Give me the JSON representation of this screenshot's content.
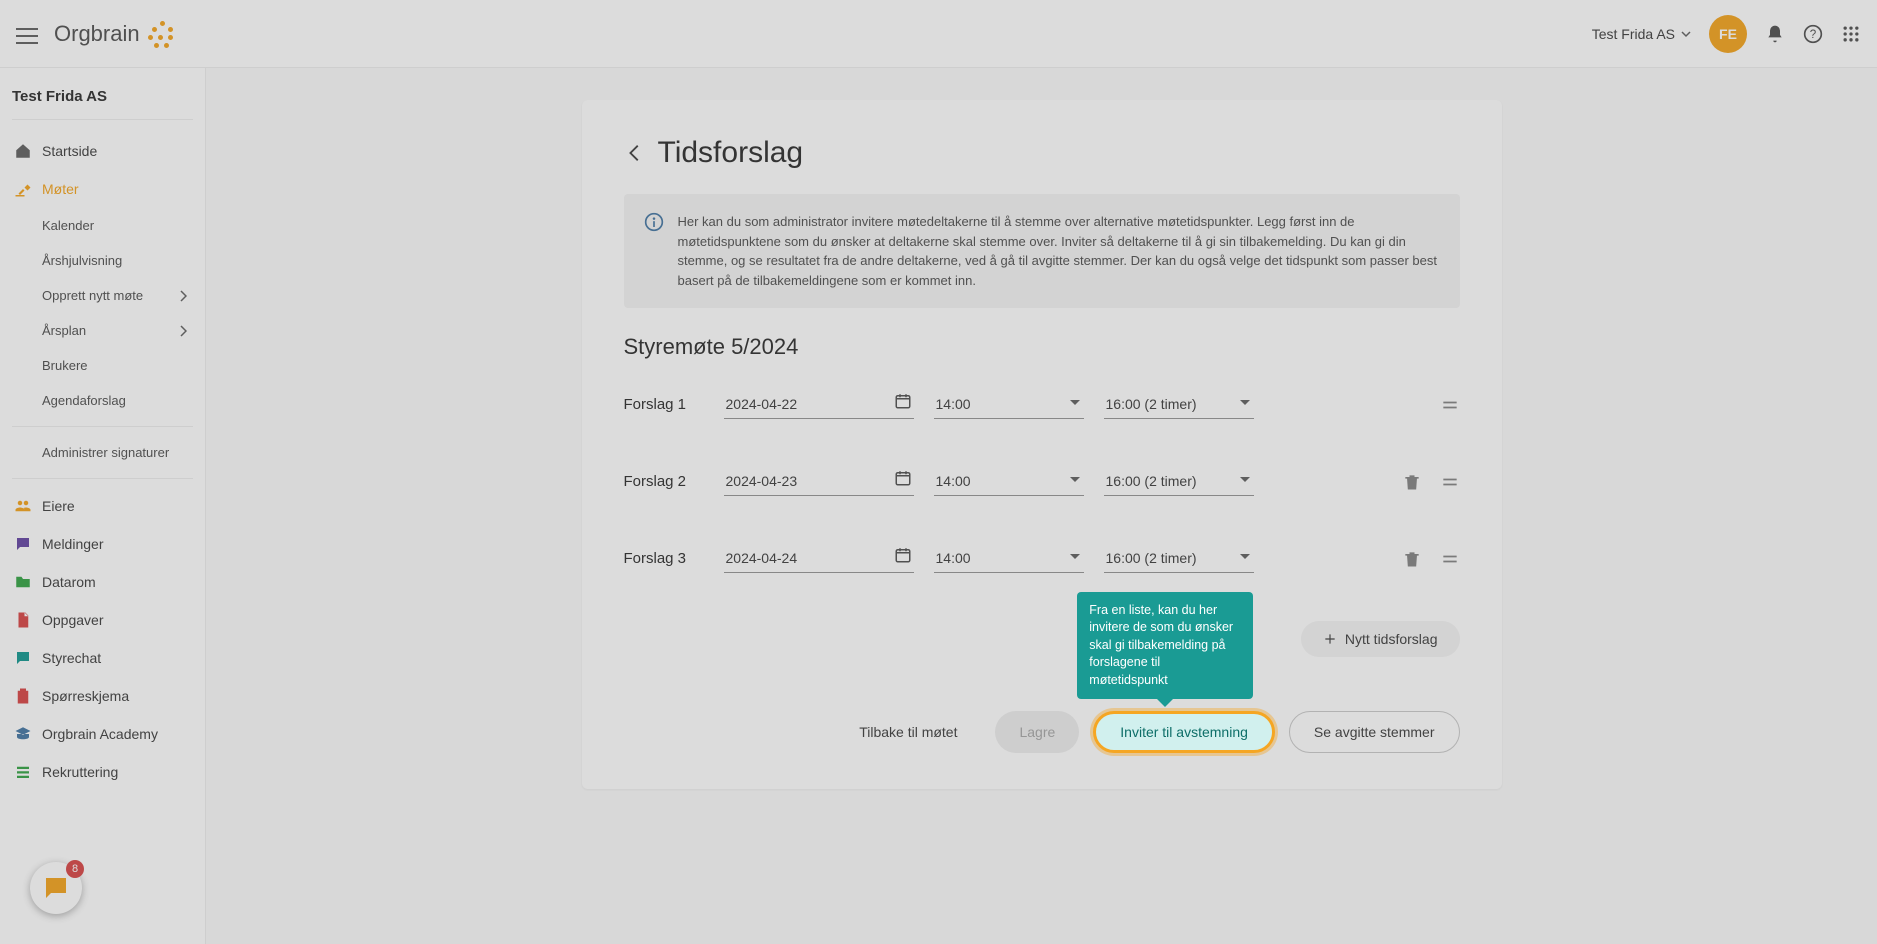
{
  "header": {
    "org_name": "Test Frida AS",
    "avatar": "FE"
  },
  "sidebar": {
    "title": "Test Frida AS",
    "items": [
      {
        "label": "Startside",
        "icon": "home"
      },
      {
        "label": "Møter",
        "icon": "gavel",
        "active": true
      },
      {
        "label": "Kalender",
        "sub": true
      },
      {
        "label": "Årshjulvisning",
        "sub": true
      },
      {
        "label": "Opprett nytt møte",
        "sub": true,
        "arrow": true
      },
      {
        "label": "Årsplan",
        "sub": true,
        "arrow": true
      },
      {
        "label": "Brukere",
        "sub": true
      },
      {
        "label": "Agendaforslag",
        "sub": true
      },
      {
        "label": "Administrer signaturer",
        "sub": true,
        "divider_before": true
      },
      {
        "label": "Eiere",
        "icon": "people",
        "color": "orange",
        "divider_before": true
      },
      {
        "label": "Meldinger",
        "icon": "message",
        "color": "purple"
      },
      {
        "label": "Datarom",
        "icon": "folder",
        "color": "green"
      },
      {
        "label": "Oppgaver",
        "icon": "file",
        "color": "red"
      },
      {
        "label": "Styrechat",
        "icon": "chat",
        "color": "teal"
      },
      {
        "label": "Spørreskjema",
        "icon": "clipboard",
        "color": "red"
      },
      {
        "label": "Orgbrain Academy",
        "icon": "academy",
        "color": "blue"
      },
      {
        "label": "Rekruttering",
        "icon": "list",
        "color": "green"
      }
    ]
  },
  "chat_badge": "8",
  "page": {
    "title": "Tidsforslag",
    "info": "Her kan du som administrator invitere møtedeltakerne til å stemme over alternative møtetidspunkter. Legg først inn de møtetidspunktene som du ønsker at deltakerne skal stemme over. Inviter så deltakerne til å gi sin tilbakemelding. Du kan gi din stemme, og se resultatet fra de andre deltakerne, ved å gå til avgitte stemmer. Der kan du også velge det tidspunkt som passer best basert på de tilbakemeldingene som er kommet inn.",
    "meeting": "Styremøte 5/2024",
    "proposals": [
      {
        "label": "Forslag 1",
        "date": "2024-04-22",
        "time": "14:00",
        "duration": "16:00 (2 timer)",
        "deletable": false
      },
      {
        "label": "Forslag 2",
        "date": "2024-04-23",
        "time": "14:00",
        "duration": "16:00 (2 timer)",
        "deletable": true
      },
      {
        "label": "Forslag 3",
        "date": "2024-04-24",
        "time": "14:00",
        "duration": "16:00 (2 timer)",
        "deletable": true
      }
    ],
    "add_label": "Nytt tidsforslag",
    "actions": {
      "back": "Tilbake til møtet",
      "save": "Lagre",
      "invite": "Inviter til avstemning",
      "votes": "Se avgitte stemmer"
    },
    "tooltip": "Fra en liste, kan du her invitere de som du ønsker skal gi tilbakemelding på forslagene til møtetidspunkt"
  }
}
